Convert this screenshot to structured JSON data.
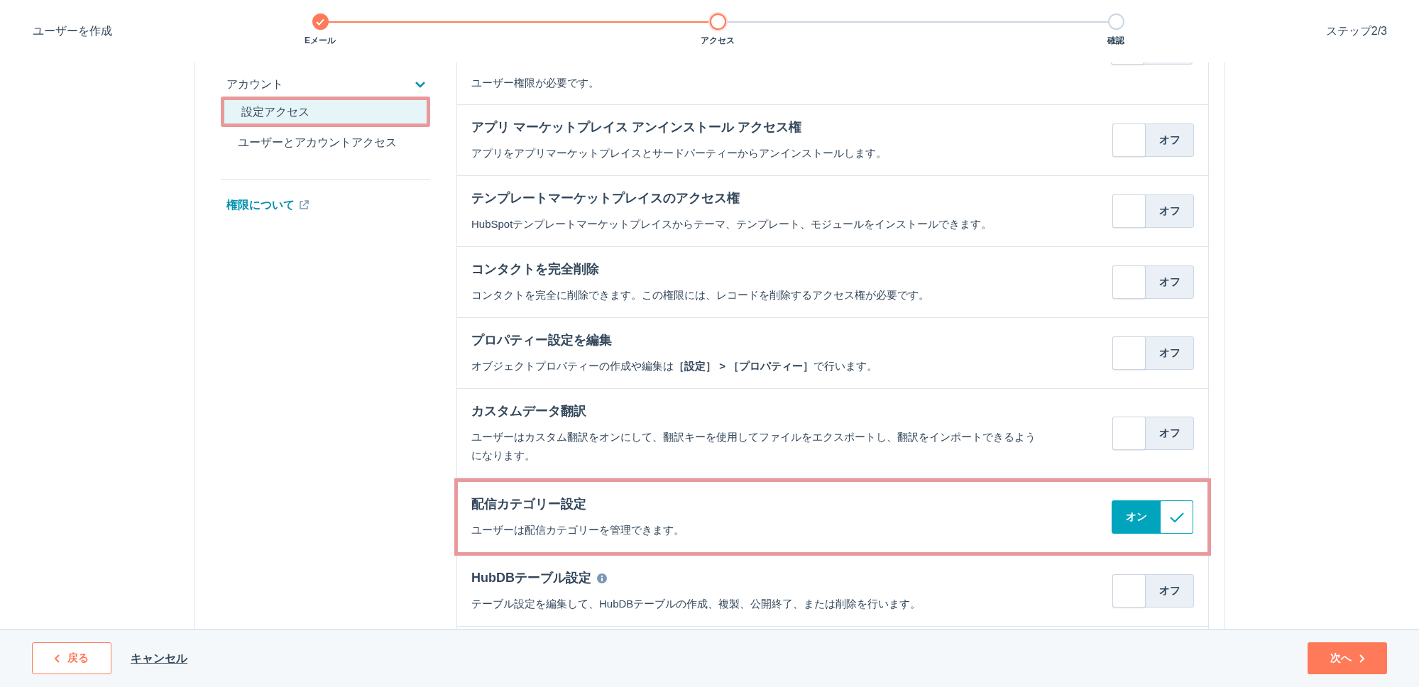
{
  "header": {
    "title": "ユーザーを作成",
    "steps": [
      {
        "label": "Eメール",
        "completed": true,
        "selected": false
      },
      {
        "label": "アクセス",
        "completed": false,
        "selected": true
      },
      {
        "label": "確認",
        "completed": false,
        "selected": false
      }
    ],
    "step_count": "ステップ2/3"
  },
  "sidebar": {
    "group": {
      "label": "アカウント",
      "expanded": true,
      "items": [
        {
          "label": "設定アクセス",
          "selected": true
        },
        {
          "label": "ユーザーとアカウントアクセス",
          "selected": false
        }
      ]
    },
    "link": "権限について"
  },
  "permissions": [
    {
      "kind": "partial",
      "description": "ユーザー権限が必要です。",
      "on": false
    },
    {
      "kind": "full",
      "title": "アプリ マーケットプレイス アンインストール アクセス権",
      "description": "アプリをアプリマーケットプレイスとサードパーティーからアンインストールします。",
      "on": false,
      "toggle_label": "オフ",
      "highlighted": false,
      "info": false
    },
    {
      "kind": "full",
      "title": "テンプレートマーケットプレイスのアクセス権",
      "description": "HubSpotテンプレートマーケットプレイスからテーマ、テンプレート、モジュールをインストールできます。",
      "on": false,
      "toggle_label": "オフ",
      "highlighted": false,
      "info": false
    },
    {
      "kind": "full",
      "title": "コンタクトを完全削除",
      "description": "コンタクトを完全に削除できます。この権限には、レコードを削除するアクセス権が必要です。",
      "on": false,
      "toggle_label": "オフ",
      "highlighted": false,
      "info": false
    },
    {
      "kind": "full",
      "title": "プロパティー設定を編集",
      "description": "オブジェクトプロパティーの作成や編集は**［設定］ > ［プロパティー］**で行います。",
      "on": false,
      "toggle_label": "オフ",
      "highlighted": false,
      "info": false
    },
    {
      "kind": "full",
      "title": "カスタムデータ翻訳",
      "description": "ユーザーはカスタム翻訳をオンにして、翻訳キーを使用してファイルをエクスポートし、翻訳をインポートできるようになります。",
      "on": false,
      "toggle_label": "オフ",
      "highlighted": false,
      "info": false
    },
    {
      "kind": "full",
      "title": "配信カテゴリー設定",
      "description": "ユーザーは配信カテゴリーを管理できます。",
      "on": true,
      "toggle_label": "オン",
      "highlighted": true,
      "info": false
    },
    {
      "kind": "full",
      "title": "HubDBテーブル設定",
      "description": "テーブル設定を編集して、HubDBテーブルの作成、複製、公開終了、または削除を行います。",
      "on": false,
      "toggle_label": "オフ",
      "highlighted": false,
      "info": true
    }
  ],
  "footer": {
    "back": "戻る",
    "cancel": "キャンセル",
    "next": "次へ"
  }
}
